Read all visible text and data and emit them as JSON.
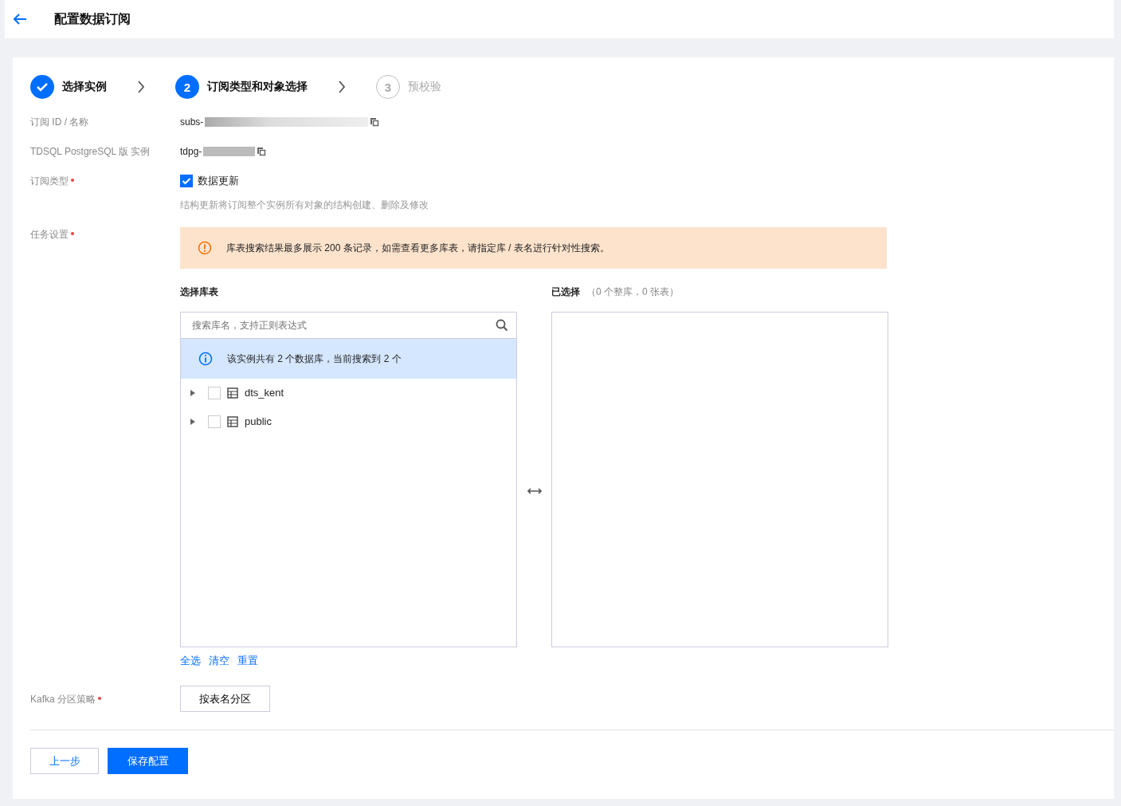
{
  "header": {
    "title": "配置数据订阅"
  },
  "steps": [
    {
      "label": "选择实例",
      "done": true,
      "current": false
    },
    {
      "number": "2",
      "label": "订阅类型和对象选择",
      "done": false,
      "current": true
    },
    {
      "number": "3",
      "label": "预校验",
      "done": false,
      "current": false
    }
  ],
  "fields": {
    "subscription": {
      "label": "订阅 ID / 名称",
      "value": "subs-"
    },
    "instance": {
      "label": "TDSQL PostgreSQL 版 实例",
      "value": "tdpg-"
    },
    "subscription_type": {
      "label": "订阅类型",
      "required": true,
      "option": "数据更新",
      "checked": true,
      "hint": "结构更新将订阅整个实例所有对象的结构创建、删除及修改"
    },
    "task_settings": {
      "label": "任务设置",
      "required": true
    },
    "kafka": {
      "label": "Kafka 分区策略",
      "required": true,
      "value": "按表名分区"
    }
  },
  "alert": {
    "text": "库表搜索结果最多展示 200 条记录，如需查看更多库表，请指定库 / 表名进行针对性搜索。"
  },
  "source": {
    "title": "选择库表",
    "search": {
      "placeholder": "搜索库名，支持正则表达式"
    },
    "info": "该实例共有 2 个数据库，当前搜索到 2 个",
    "items": [
      {
        "name": "dts_kent",
        "expanded": false,
        "checked": false
      },
      {
        "name": "public",
        "expanded": false,
        "checked": false
      }
    ],
    "actions": [
      "全选",
      "清空",
      "重置"
    ]
  },
  "target": {
    "title": "已选择",
    "summary": "（0 个整库，0 张表）"
  },
  "footer": {
    "back": "上一步",
    "save": "保存配置"
  }
}
